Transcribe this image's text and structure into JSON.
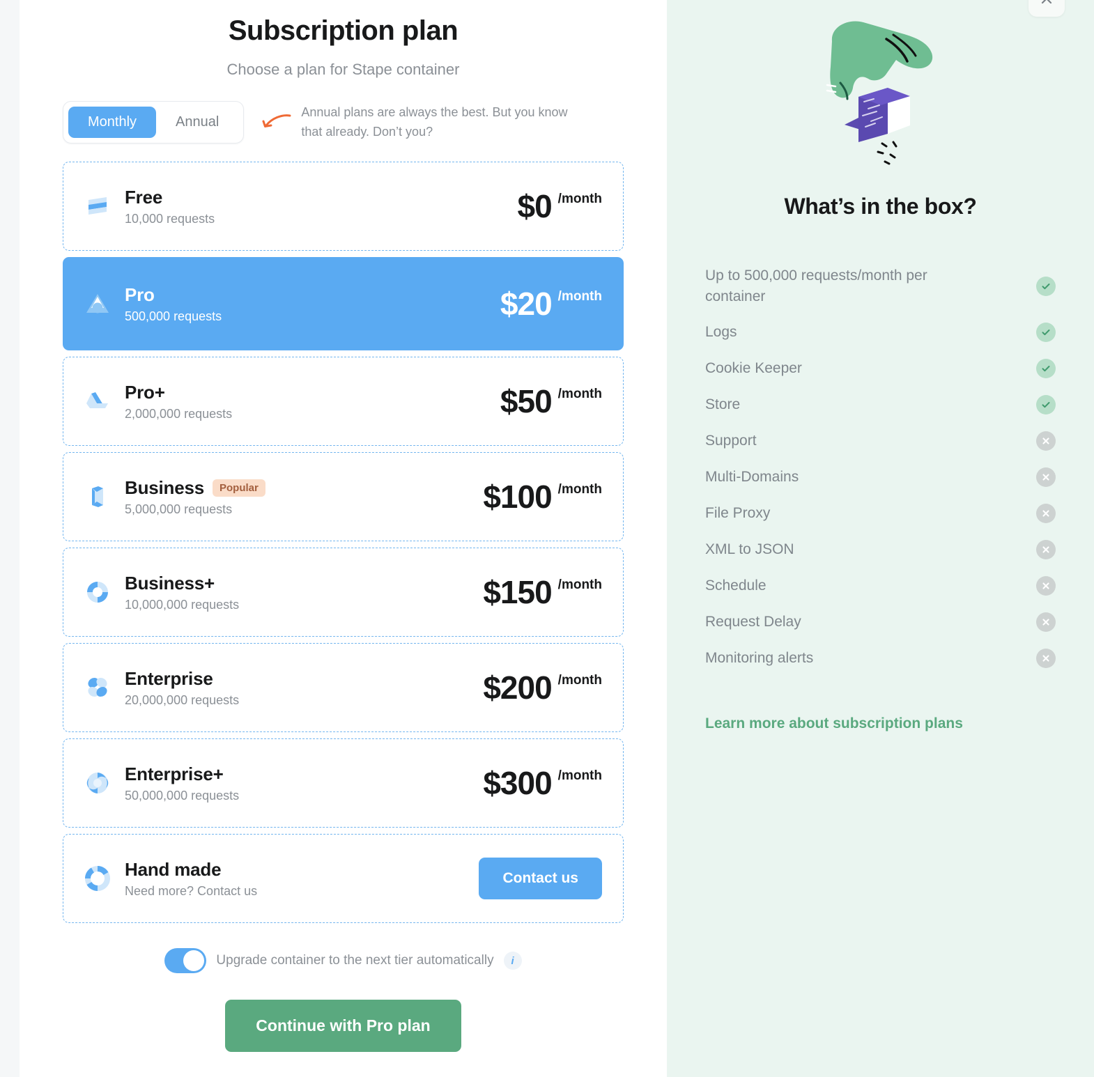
{
  "header": {
    "title": "Subscription plan",
    "subtitle": "Choose a plan for Stape container"
  },
  "billing": {
    "options": [
      "Monthly",
      "Annual"
    ],
    "selected": "Monthly",
    "hint": "Annual plans are always the best. But you know that already. Don’t you?",
    "arrow_icon": "curved-arrow-left-icon",
    "arrow_color": "#ef6a35"
  },
  "plans": [
    {
      "name": "Free",
      "requests": "10,000 requests",
      "price": "$0",
      "period": "/month",
      "icon": "stack-icon",
      "selected": false,
      "badge": null
    },
    {
      "name": "Pro",
      "requests": "500,000 requests",
      "price": "$20",
      "period": "/month",
      "icon": "triangle-icon",
      "selected": true,
      "badge": null
    },
    {
      "name": "Pro+",
      "requests": "2,000,000 requests",
      "price": "$50",
      "period": "/month",
      "icon": "drive-icon",
      "selected": false,
      "badge": null
    },
    {
      "name": "Business",
      "requests": "5,000,000 requests",
      "price": "$100",
      "period": "/month",
      "icon": "cube-icon",
      "selected": false,
      "badge": "Popular"
    },
    {
      "name": "Business+",
      "requests": "10,000,000 requests",
      "price": "$150",
      "period": "/month",
      "icon": "pinwheel-icon",
      "selected": false,
      "badge": null
    },
    {
      "name": "Enterprise",
      "requests": "20,000,000 requests",
      "price": "$200",
      "period": "/month",
      "icon": "flower-icon",
      "selected": false,
      "badge": null
    },
    {
      "name": "Enterprise+",
      "requests": "50,000,000 requests",
      "price": "$300",
      "period": "/month",
      "icon": "swirl-icon",
      "selected": false,
      "badge": null
    }
  ],
  "handmade": {
    "name": "Hand made",
    "requests": "Need more? Contact us",
    "icon": "ring-icon",
    "button_label": "Contact us"
  },
  "footer": {
    "upgrade_label": "Upgrade container to the next tier automatically",
    "upgrade_enabled": true,
    "info_icon": "info-icon",
    "continue_label": "Continue with Pro plan"
  },
  "sidebar": {
    "close_icon": "close-icon",
    "illustration": "hand-opening-box-illustration",
    "title": "What’s in the box?",
    "features": [
      {
        "label": "Up to 500,000 requests/month per container",
        "included": true
      },
      {
        "label": "Logs",
        "included": true
      },
      {
        "label": "Cookie Keeper",
        "included": true
      },
      {
        "label": "Store",
        "included": true
      },
      {
        "label": "Support",
        "included": false
      },
      {
        "label": "Multi-Domains",
        "included": false
      },
      {
        "label": "File Proxy",
        "included": false
      },
      {
        "label": "XML to JSON",
        "included": false
      },
      {
        "label": "Schedule",
        "included": false
      },
      {
        "label": "Request Delay",
        "included": false
      },
      {
        "label": "Monitoring alerts",
        "included": false
      }
    ],
    "learn_more": "Learn more about subscription plans"
  },
  "colors": {
    "accent_blue": "#5aaaf2",
    "accent_green": "#5aa97f",
    "panel_bg": "#eaf5f0",
    "badge_bg": "#fadcc8",
    "arrow_orange": "#ef6a35"
  }
}
